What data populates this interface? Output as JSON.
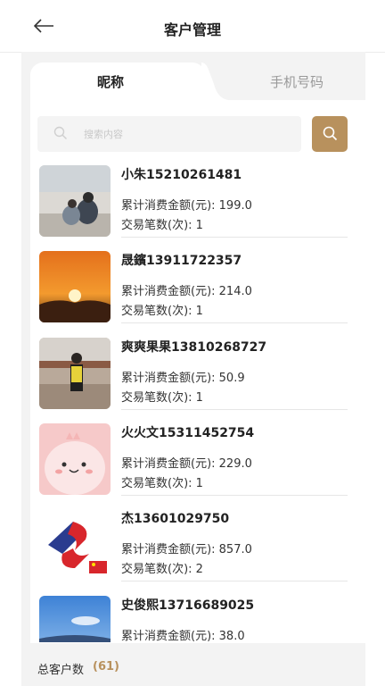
{
  "header": {
    "title": "客户管理"
  },
  "tabs": {
    "nickname": "昵称",
    "phone": "手机号码"
  },
  "search": {
    "placeholder": "搜索内容"
  },
  "customers": [
    {
      "name": "小朱15210261481",
      "spend": "累计消费金额(元): 199.0",
      "count": "交易笔数(次): 1"
    },
    {
      "name": "晟鑌13911722357",
      "spend": "累计消费金额(元): 214.0",
      "count": "交易笔数(次): 1"
    },
    {
      "name": " 爽爽果果13810268727",
      "spend": "累计消费金额(元): 50.9",
      "count": "交易笔数(次): 1"
    },
    {
      "name": "火火文15311452754",
      "spend": "累计消费金额(元): 229.0",
      "count": "交易笔数(次): 1"
    },
    {
      "name": "杰13601029750",
      "spend": "累计消费金额(元): 857.0",
      "count": "交易笔数(次): 2"
    },
    {
      "name": "史俊熙13716689025",
      "spend": "累计消费金额(元): 38.0",
      "count": ""
    }
  ],
  "footer": {
    "label": "总客户数",
    "count": "(61)"
  },
  "colors": {
    "accent": "#b8915d",
    "panel": "#f3f3f3"
  }
}
